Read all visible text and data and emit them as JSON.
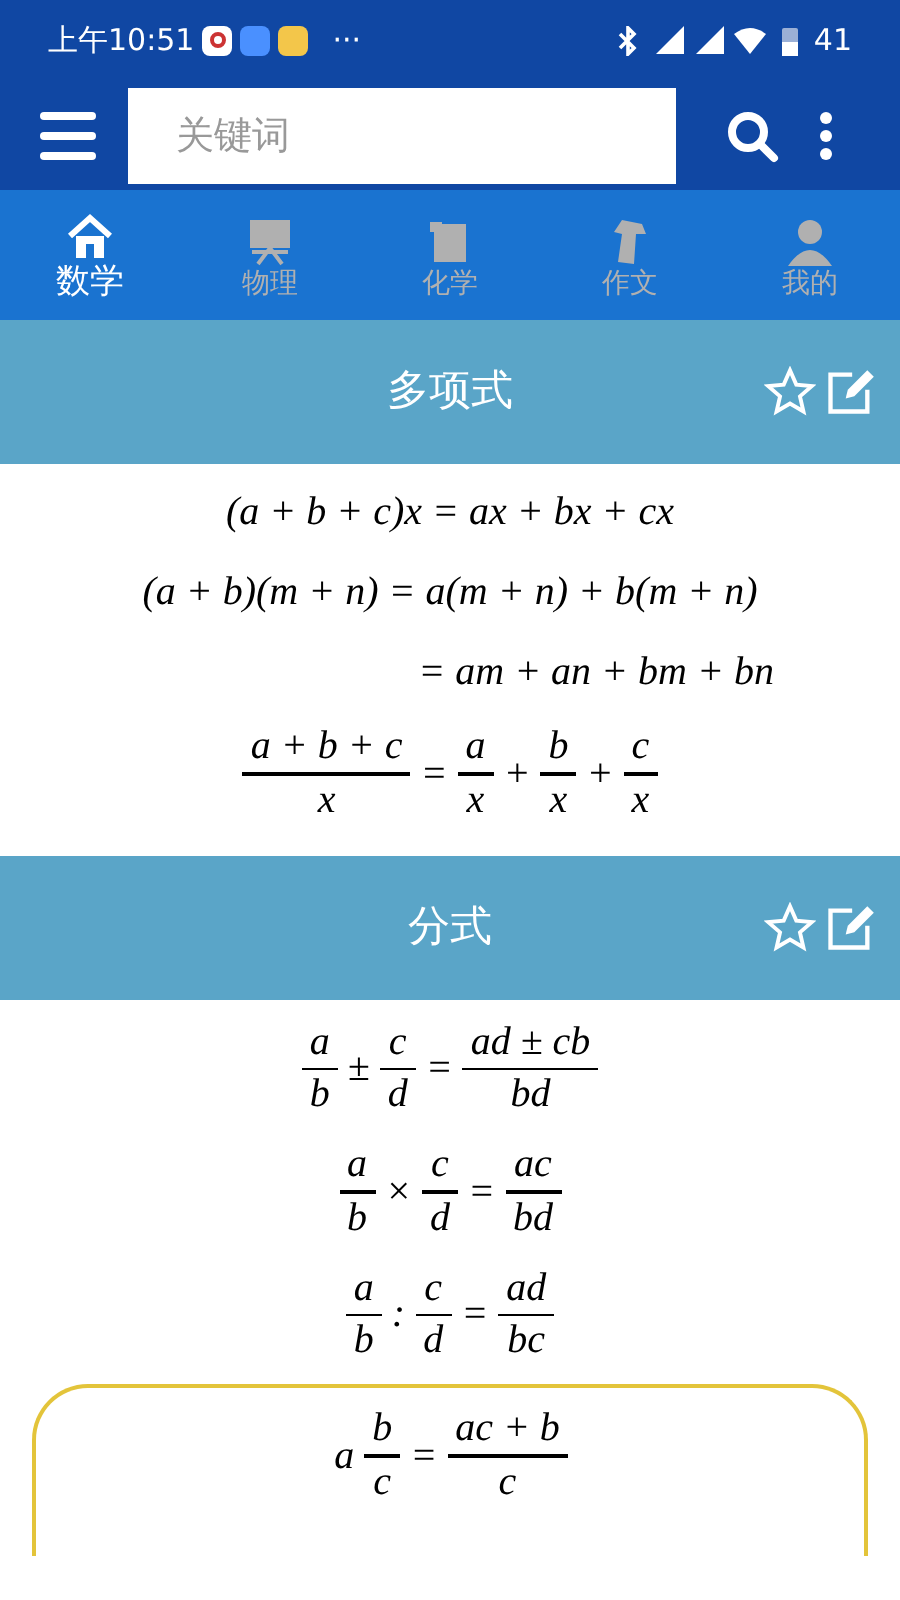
{
  "status_bar": {
    "time": "上午10:51",
    "more": "···",
    "battery": "41"
  },
  "search": {
    "placeholder": "关键词"
  },
  "tabs": [
    {
      "label": "数学",
      "selected": true
    },
    {
      "label": "物理",
      "selected": false
    },
    {
      "label": "化学",
      "selected": false
    },
    {
      "label": "作文",
      "selected": false
    },
    {
      "label": "我的",
      "selected": false
    }
  ],
  "sections": [
    {
      "title": "多项式",
      "formulas": [
        {
          "kind": "line",
          "highlighted": false,
          "parts": [
            {
              "kind": "text",
              "text": "(a + b + c)x = ax + bx + cx"
            }
          ]
        },
        {
          "kind": "line",
          "highlighted": false,
          "parts": [
            {
              "kind": "text",
              "text": "(a + b)(m + n) = a(m + n) + b(m + n)"
            }
          ]
        },
        {
          "kind": "continued",
          "highlighted": false,
          "parts": [
            {
              "kind": "text",
              "text": "= am + an + bm + bn"
            }
          ]
        },
        {
          "kind": "line",
          "highlighted": false,
          "parts": [
            {
              "kind": "frac",
              "num": "a + b + c",
              "den": "x"
            },
            {
              "kind": "text",
              "text": "="
            },
            {
              "kind": "frac",
              "num": "a",
              "den": "x"
            },
            {
              "kind": "text",
              "text": "+"
            },
            {
              "kind": "frac",
              "num": "b",
              "den": "x"
            },
            {
              "kind": "text",
              "text": "+"
            },
            {
              "kind": "frac",
              "num": "c",
              "den": "x"
            }
          ]
        }
      ]
    },
    {
      "title": "分式",
      "formulas": [
        {
          "kind": "line",
          "highlighted": false,
          "parts": [
            {
              "kind": "frac",
              "num": "a",
              "den": "b"
            },
            {
              "kind": "text",
              "text": "±"
            },
            {
              "kind": "frac",
              "num": "c",
              "den": "d"
            },
            {
              "kind": "text",
              "text": "="
            },
            {
              "kind": "frac",
              "num": "ad ± cb",
              "den": "bd"
            }
          ]
        },
        {
          "kind": "line",
          "highlighted": false,
          "parts": [
            {
              "kind": "frac",
              "num": "a",
              "den": "b"
            },
            {
              "kind": "text",
              "text": "×"
            },
            {
              "kind": "frac",
              "num": "c",
              "den": "d"
            },
            {
              "kind": "text",
              "text": "="
            },
            {
              "kind": "frac",
              "num": "ac",
              "den": "bd"
            }
          ]
        },
        {
          "kind": "line",
          "highlighted": false,
          "parts": [
            {
              "kind": "frac",
              "num": "a",
              "den": "b"
            },
            {
              "kind": "text",
              "text": ":"
            },
            {
              "kind": "frac",
              "num": "c",
              "den": "d"
            },
            {
              "kind": "text",
              "text": "="
            },
            {
              "kind": "frac",
              "num": "ad",
              "den": "bc"
            }
          ]
        },
        {
          "kind": "line",
          "highlighted": true,
          "parts": [
            {
              "kind": "text",
              "text": "a"
            },
            {
              "kind": "frac",
              "num": "b",
              "den": "c"
            },
            {
              "kind": "text",
              "text": "="
            },
            {
              "kind": "frac",
              "num": "ac + b",
              "den": "c"
            }
          ]
        }
      ]
    }
  ]
}
